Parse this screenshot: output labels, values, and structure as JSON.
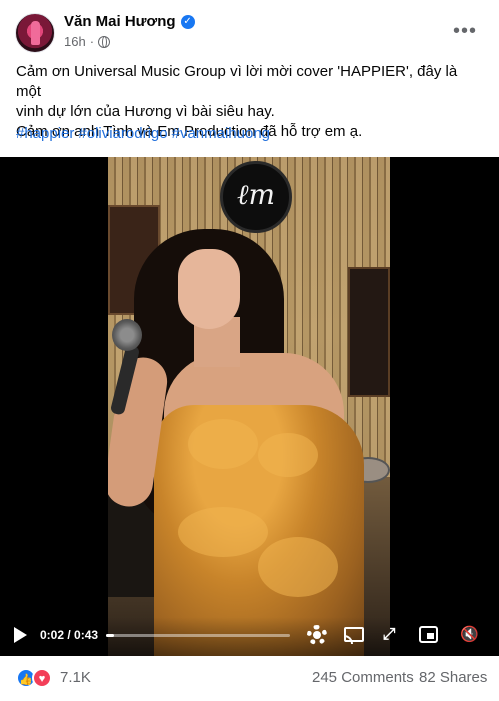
{
  "post": {
    "author": "Văn Mai Hương",
    "timestamp": "16h",
    "privacy_icon": "globe-icon",
    "verified_icon": "verified-badge-icon",
    "text_lines": [
      "Cảm ơn Universal Music Group vì lời mời cover 'HAPPIER', đây là một",
      "vinh dự lớn của Hương vì bài siêu hay.",
      "Cảm ơn anh Tình và Em Production đã hỗ trợ em ạ."
    ],
    "hashtags": [
      "#happier",
      "#oliviarodrigo",
      "#vanmaihuong"
    ]
  },
  "video": {
    "time_display": "0:02 / 0:43",
    "progress_fraction": 0.046,
    "controls": {
      "play": "play-icon",
      "settings": "gear-icon",
      "cast": "cast-icon",
      "fullscreen": "expand-icon",
      "pip": "picture-in-picture-icon",
      "volume": "volume-muted-icon"
    }
  },
  "footer": {
    "reaction_count": "7.1K",
    "comments": "245 Comments",
    "shares": "82 Shares"
  },
  "colors": {
    "link": "#216fdb",
    "secondary_text": "#65676b",
    "like_blue": "#1877f2",
    "love_red": "#f33e58"
  }
}
